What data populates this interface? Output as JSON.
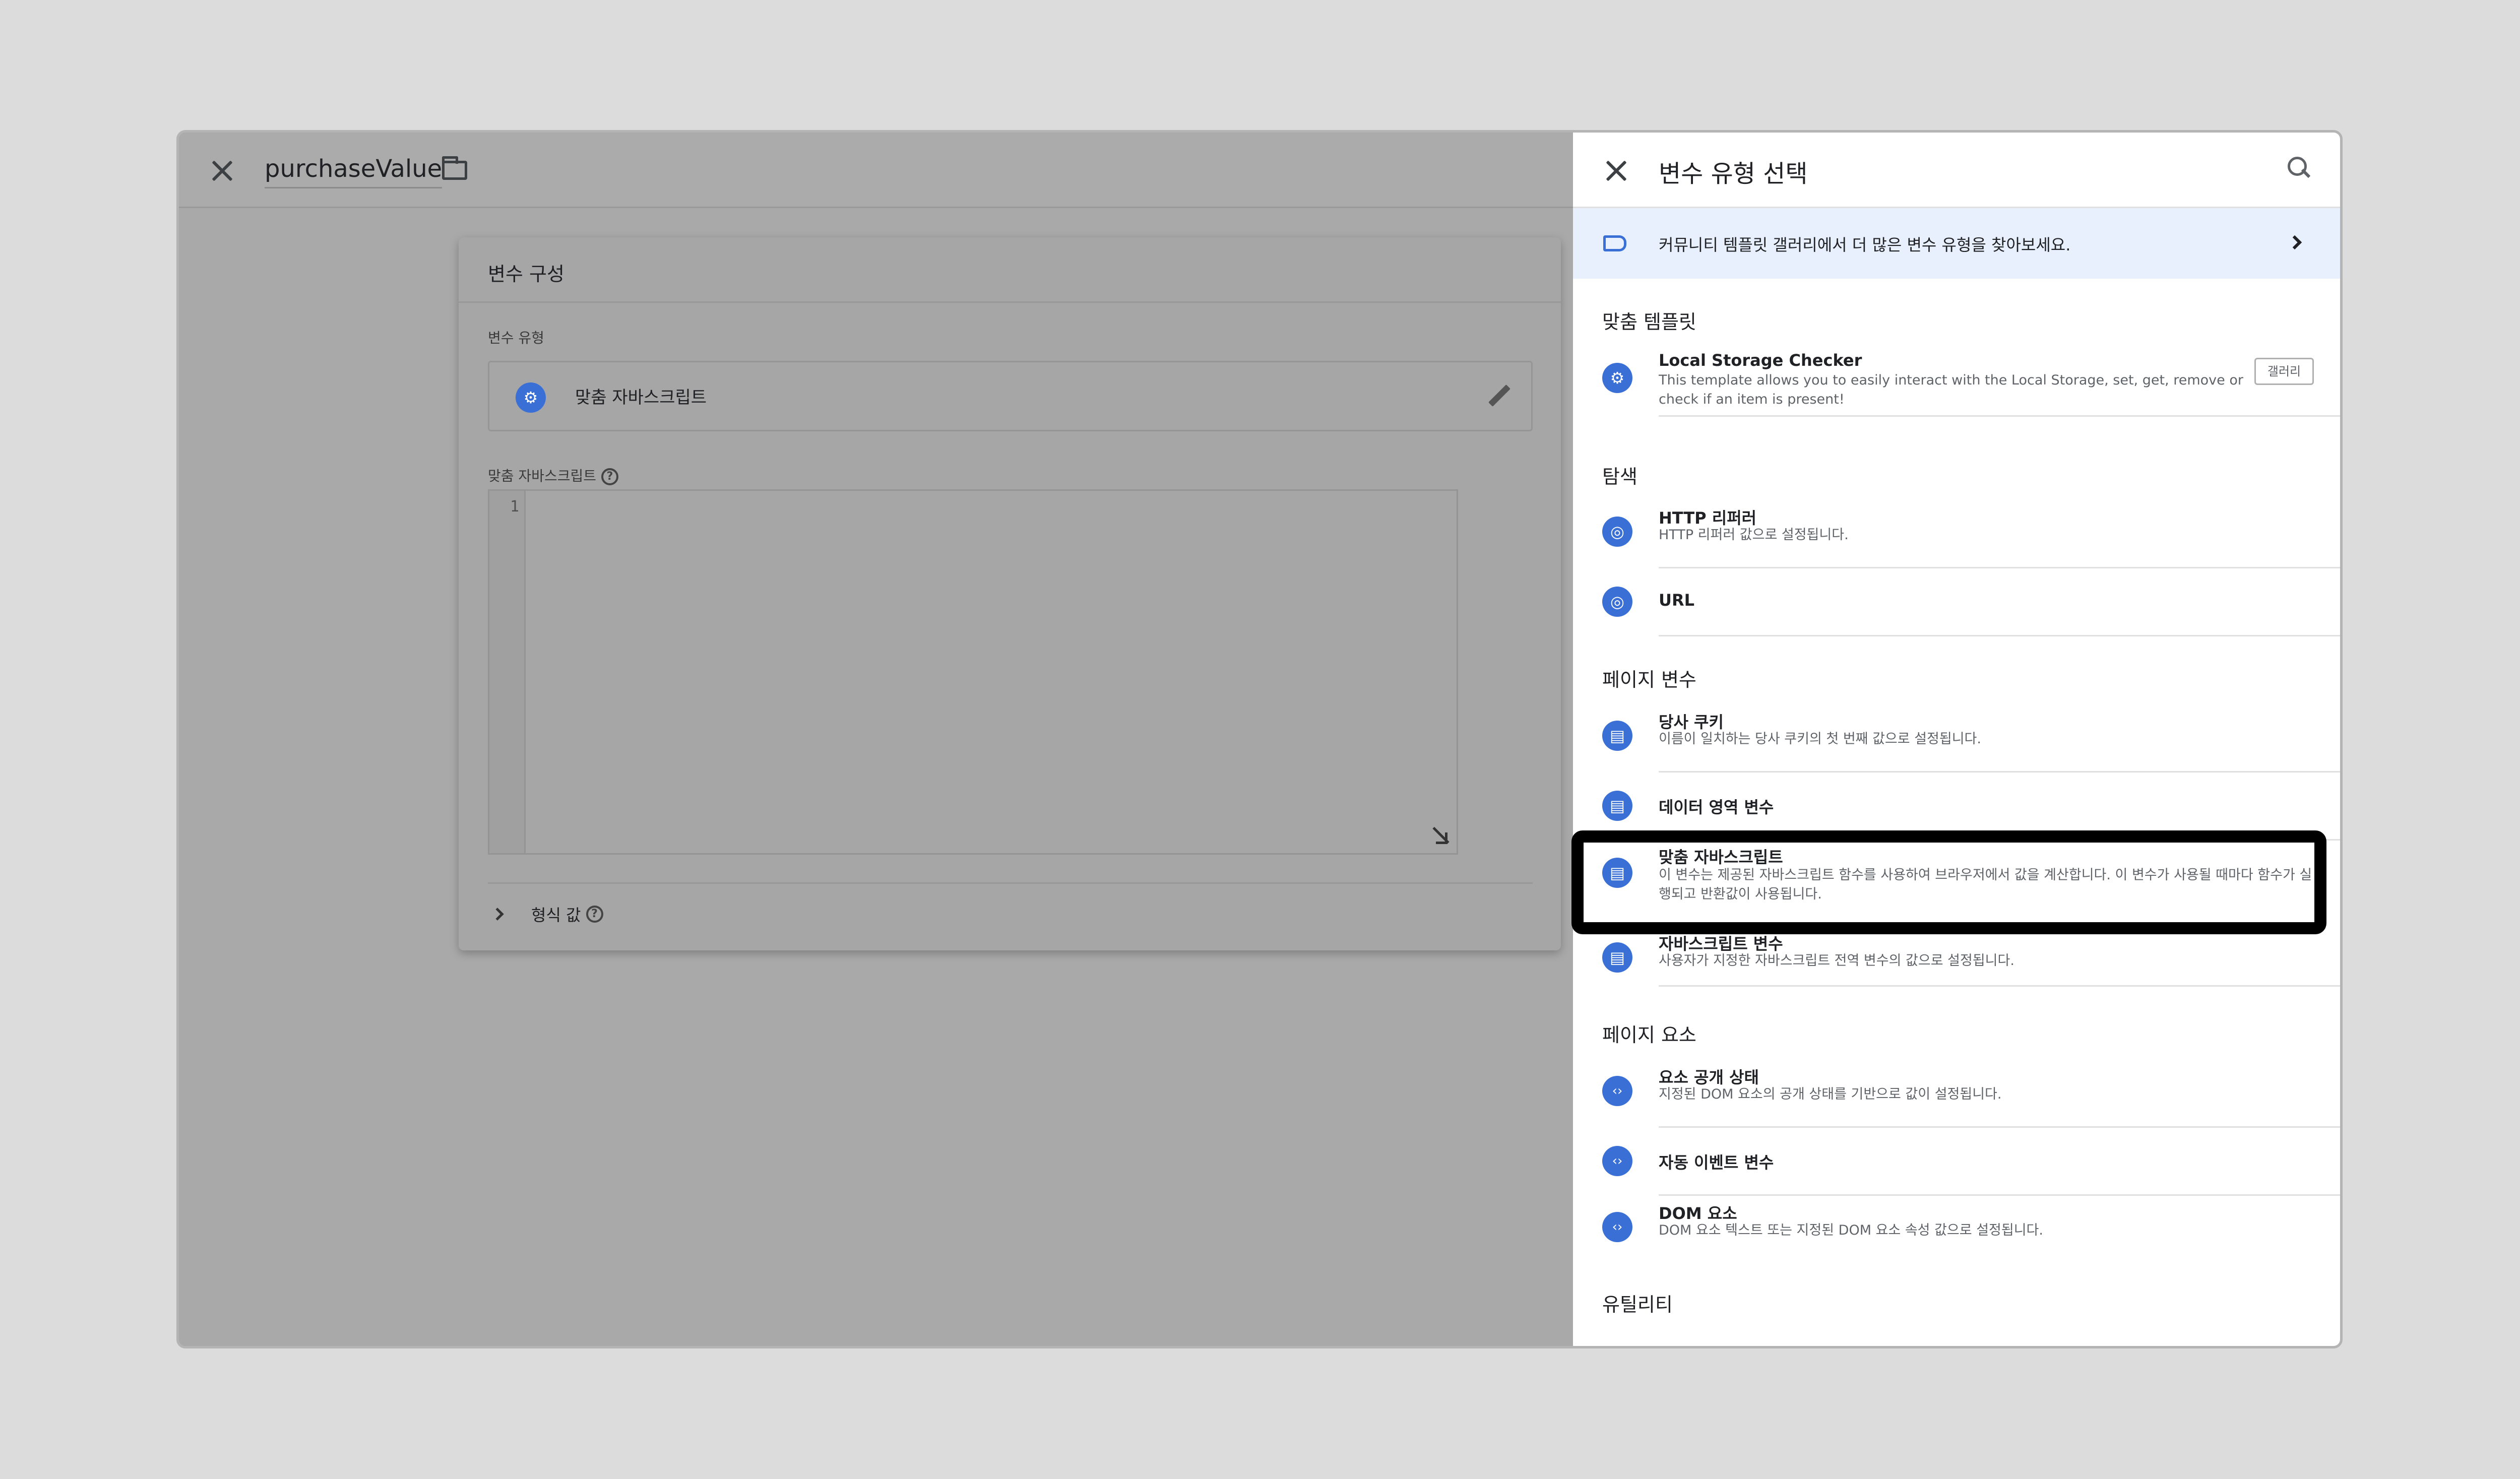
{
  "editor": {
    "title": "purchaseValue",
    "card_title": "변수 구성",
    "type_label": "변수 유형",
    "type_value": "맞춤 자바스크립트",
    "code_label": "맞춤 자바스크립트",
    "line_number": "1",
    "format_label": "형식 값"
  },
  "panel": {
    "title": "변수 유형 선택",
    "banner": "커뮤니티 템플릿 갤러리에서 더 많은 변수 유형을 찾아보세요.",
    "sections": [
      {
        "title": "맞춤 템플릿",
        "items": [
          {
            "title": "Local Storage Checker",
            "desc": "This template allows you to easily interact with the Local Storage, set, get, remove or check if an item is present!",
            "icon": "gear-icon",
            "badge": "갤러리"
          }
        ]
      },
      {
        "title": "탐색",
        "items": [
          {
            "title": "HTTP 리퍼러",
            "desc": "HTTP 리퍼러 값으로 설정됩니다.",
            "icon": "globe-icon"
          },
          {
            "title": "URL",
            "desc": "",
            "icon": "globe-icon"
          }
        ]
      },
      {
        "title": "페이지 변수",
        "items": [
          {
            "title": "당사 쿠키",
            "desc": "이름이 일치하는 당사 쿠키의 첫 번째 값으로 설정됩니다.",
            "icon": "document-icon"
          },
          {
            "title": "데이터 영역 변수",
            "desc": "",
            "icon": "document-icon"
          },
          {
            "title": "맞춤 자바스크립트",
            "desc": "이 변수는 제공된 자바스크립트 함수를 사용하여 브라우저에서 값을 계산합니다. 이 변수가 사용될 때마다 함수가 실행되고 반환값이 사용됩니다.",
            "icon": "document-icon"
          },
          {
            "title": "자바스크립트 변수",
            "desc": "사용자가 지정한 자바스크립트 전역 변수의 값으로 설정됩니다.",
            "icon": "document-icon"
          }
        ]
      },
      {
        "title": "페이지 요소",
        "items": [
          {
            "title": "요소 공개 상태",
            "desc": "지정된 DOM 요소의 공개 상태를 기반으로 값이 설정됩니다.",
            "icon": "code-icon"
          },
          {
            "title": "자동 이벤트 변수",
            "desc": "",
            "icon": "code-icon"
          },
          {
            "title": "DOM 요소",
            "desc": "DOM 요소 텍스트 또는 지정된 DOM 요소 속성 값으로 설정됩니다.",
            "icon": "code-icon"
          }
        ]
      },
      {
        "title": "유틸리티",
        "items": []
      }
    ]
  },
  "colors": {
    "accent": "#3a6fd6",
    "banner_bg": "#e8f0fe",
    "highlight": "#000000"
  }
}
